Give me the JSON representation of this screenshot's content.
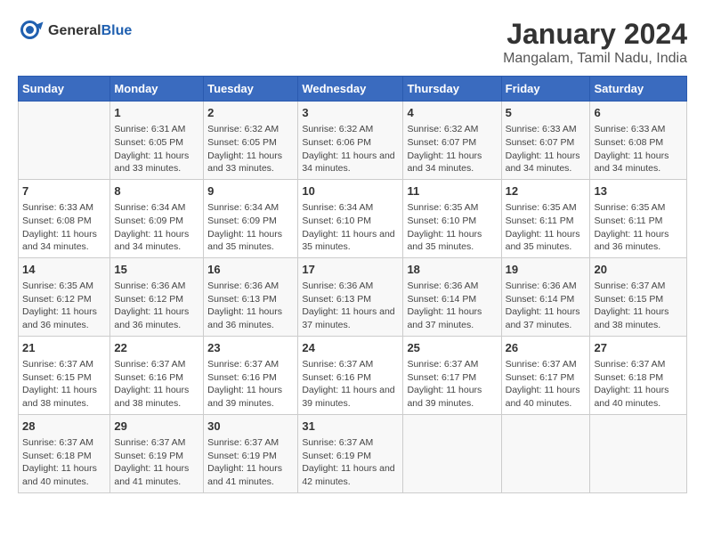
{
  "header": {
    "logo_general": "General",
    "logo_blue": "Blue",
    "title": "January 2024",
    "location": "Mangalam, Tamil Nadu, India"
  },
  "days_of_week": [
    "Sunday",
    "Monday",
    "Tuesday",
    "Wednesday",
    "Thursday",
    "Friday",
    "Saturday"
  ],
  "weeks": [
    [
      {
        "day": "",
        "sunrise": "",
        "sunset": "",
        "daylight": ""
      },
      {
        "day": "1",
        "sunrise": "Sunrise: 6:31 AM",
        "sunset": "Sunset: 6:05 PM",
        "daylight": "Daylight: 11 hours and 33 minutes."
      },
      {
        "day": "2",
        "sunrise": "Sunrise: 6:32 AM",
        "sunset": "Sunset: 6:05 PM",
        "daylight": "Daylight: 11 hours and 33 minutes."
      },
      {
        "day": "3",
        "sunrise": "Sunrise: 6:32 AM",
        "sunset": "Sunset: 6:06 PM",
        "daylight": "Daylight: 11 hours and 34 minutes."
      },
      {
        "day": "4",
        "sunrise": "Sunrise: 6:32 AM",
        "sunset": "Sunset: 6:07 PM",
        "daylight": "Daylight: 11 hours and 34 minutes."
      },
      {
        "day": "5",
        "sunrise": "Sunrise: 6:33 AM",
        "sunset": "Sunset: 6:07 PM",
        "daylight": "Daylight: 11 hours and 34 minutes."
      },
      {
        "day": "6",
        "sunrise": "Sunrise: 6:33 AM",
        "sunset": "Sunset: 6:08 PM",
        "daylight": "Daylight: 11 hours and 34 minutes."
      }
    ],
    [
      {
        "day": "7",
        "sunrise": "Sunrise: 6:33 AM",
        "sunset": "Sunset: 6:08 PM",
        "daylight": "Daylight: 11 hours and 34 minutes."
      },
      {
        "day": "8",
        "sunrise": "Sunrise: 6:34 AM",
        "sunset": "Sunset: 6:09 PM",
        "daylight": "Daylight: 11 hours and 34 minutes."
      },
      {
        "day": "9",
        "sunrise": "Sunrise: 6:34 AM",
        "sunset": "Sunset: 6:09 PM",
        "daylight": "Daylight: 11 hours and 35 minutes."
      },
      {
        "day": "10",
        "sunrise": "Sunrise: 6:34 AM",
        "sunset": "Sunset: 6:10 PM",
        "daylight": "Daylight: 11 hours and 35 minutes."
      },
      {
        "day": "11",
        "sunrise": "Sunrise: 6:35 AM",
        "sunset": "Sunset: 6:10 PM",
        "daylight": "Daylight: 11 hours and 35 minutes."
      },
      {
        "day": "12",
        "sunrise": "Sunrise: 6:35 AM",
        "sunset": "Sunset: 6:11 PM",
        "daylight": "Daylight: 11 hours and 35 minutes."
      },
      {
        "day": "13",
        "sunrise": "Sunrise: 6:35 AM",
        "sunset": "Sunset: 6:11 PM",
        "daylight": "Daylight: 11 hours and 36 minutes."
      }
    ],
    [
      {
        "day": "14",
        "sunrise": "Sunrise: 6:35 AM",
        "sunset": "Sunset: 6:12 PM",
        "daylight": "Daylight: 11 hours and 36 minutes."
      },
      {
        "day": "15",
        "sunrise": "Sunrise: 6:36 AM",
        "sunset": "Sunset: 6:12 PM",
        "daylight": "Daylight: 11 hours and 36 minutes."
      },
      {
        "day": "16",
        "sunrise": "Sunrise: 6:36 AM",
        "sunset": "Sunset: 6:13 PM",
        "daylight": "Daylight: 11 hours and 36 minutes."
      },
      {
        "day": "17",
        "sunrise": "Sunrise: 6:36 AM",
        "sunset": "Sunset: 6:13 PM",
        "daylight": "Daylight: 11 hours and 37 minutes."
      },
      {
        "day": "18",
        "sunrise": "Sunrise: 6:36 AM",
        "sunset": "Sunset: 6:14 PM",
        "daylight": "Daylight: 11 hours and 37 minutes."
      },
      {
        "day": "19",
        "sunrise": "Sunrise: 6:36 AM",
        "sunset": "Sunset: 6:14 PM",
        "daylight": "Daylight: 11 hours and 37 minutes."
      },
      {
        "day": "20",
        "sunrise": "Sunrise: 6:37 AM",
        "sunset": "Sunset: 6:15 PM",
        "daylight": "Daylight: 11 hours and 38 minutes."
      }
    ],
    [
      {
        "day": "21",
        "sunrise": "Sunrise: 6:37 AM",
        "sunset": "Sunset: 6:15 PM",
        "daylight": "Daylight: 11 hours and 38 minutes."
      },
      {
        "day": "22",
        "sunrise": "Sunrise: 6:37 AM",
        "sunset": "Sunset: 6:16 PM",
        "daylight": "Daylight: 11 hours and 38 minutes."
      },
      {
        "day": "23",
        "sunrise": "Sunrise: 6:37 AM",
        "sunset": "Sunset: 6:16 PM",
        "daylight": "Daylight: 11 hours and 39 minutes."
      },
      {
        "day": "24",
        "sunrise": "Sunrise: 6:37 AM",
        "sunset": "Sunset: 6:16 PM",
        "daylight": "Daylight: 11 hours and 39 minutes."
      },
      {
        "day": "25",
        "sunrise": "Sunrise: 6:37 AM",
        "sunset": "Sunset: 6:17 PM",
        "daylight": "Daylight: 11 hours and 39 minutes."
      },
      {
        "day": "26",
        "sunrise": "Sunrise: 6:37 AM",
        "sunset": "Sunset: 6:17 PM",
        "daylight": "Daylight: 11 hours and 40 minutes."
      },
      {
        "day": "27",
        "sunrise": "Sunrise: 6:37 AM",
        "sunset": "Sunset: 6:18 PM",
        "daylight": "Daylight: 11 hours and 40 minutes."
      }
    ],
    [
      {
        "day": "28",
        "sunrise": "Sunrise: 6:37 AM",
        "sunset": "Sunset: 6:18 PM",
        "daylight": "Daylight: 11 hours and 40 minutes."
      },
      {
        "day": "29",
        "sunrise": "Sunrise: 6:37 AM",
        "sunset": "Sunset: 6:19 PM",
        "daylight": "Daylight: 11 hours and 41 minutes."
      },
      {
        "day": "30",
        "sunrise": "Sunrise: 6:37 AM",
        "sunset": "Sunset: 6:19 PM",
        "daylight": "Daylight: 11 hours and 41 minutes."
      },
      {
        "day": "31",
        "sunrise": "Sunrise: 6:37 AM",
        "sunset": "Sunset: 6:19 PM",
        "daylight": "Daylight: 11 hours and 42 minutes."
      },
      {
        "day": "",
        "sunrise": "",
        "sunset": "",
        "daylight": ""
      },
      {
        "day": "",
        "sunrise": "",
        "sunset": "",
        "daylight": ""
      },
      {
        "day": "",
        "sunrise": "",
        "sunset": "",
        "daylight": ""
      }
    ]
  ]
}
